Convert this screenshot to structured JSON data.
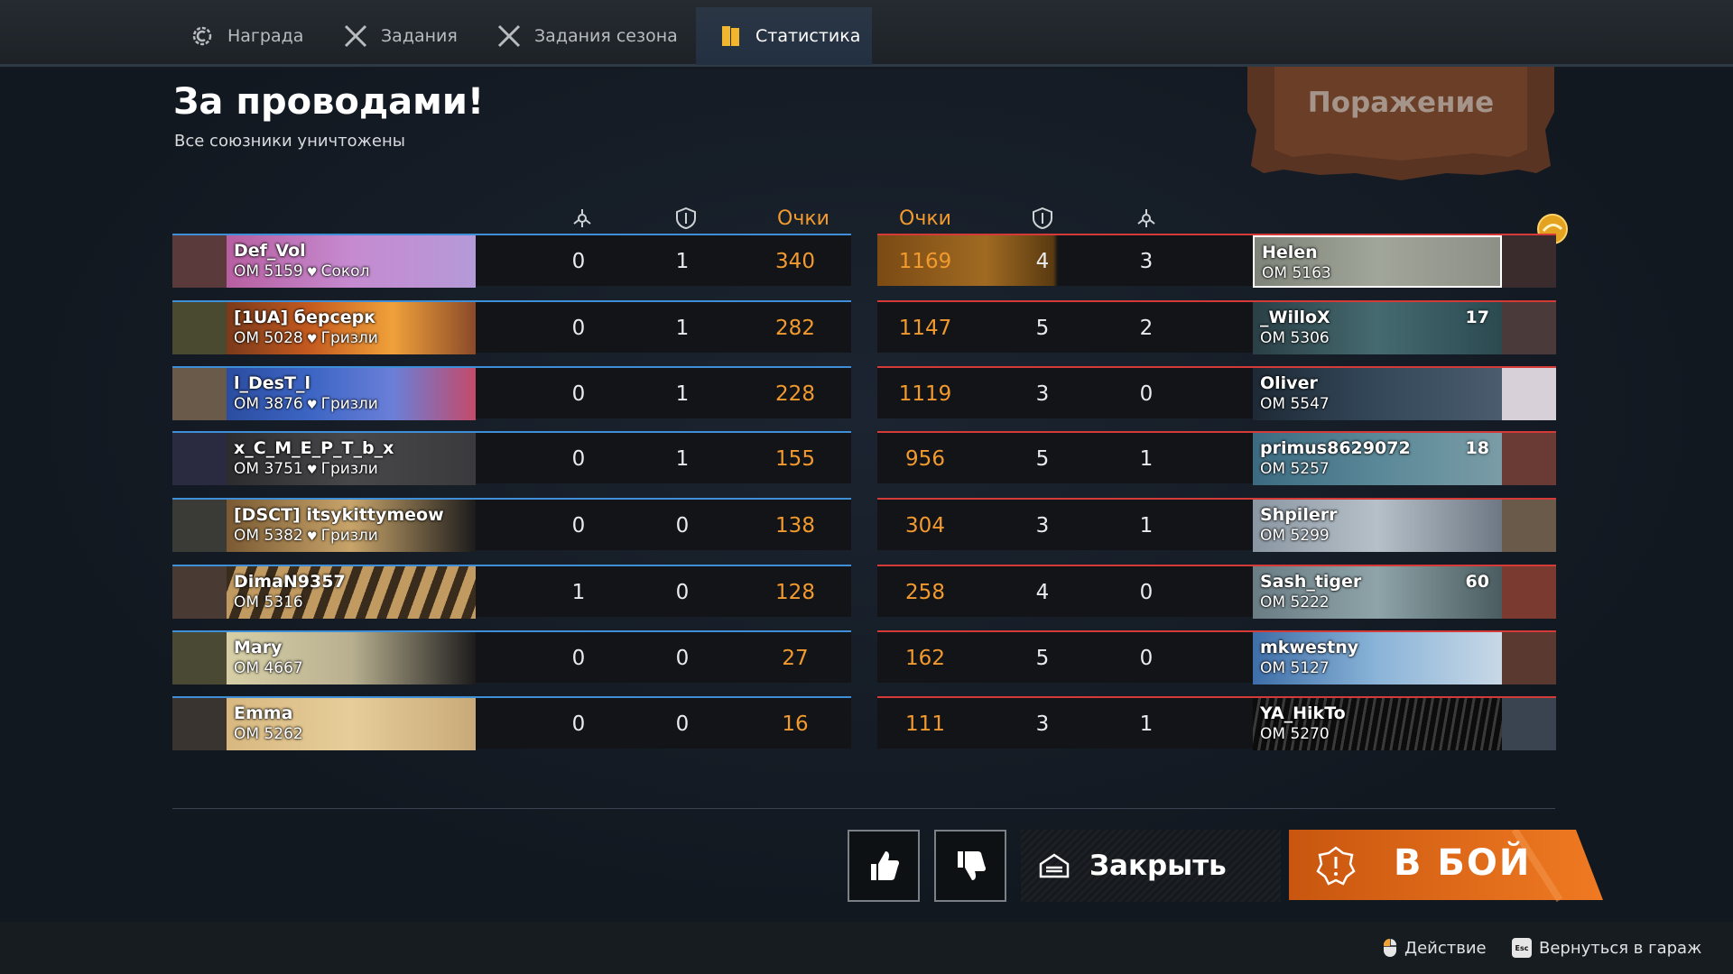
{
  "tabs": [
    {
      "label": "Награда",
      "icon": "reward-gear-icon",
      "active": false
    },
    {
      "label": "Задания",
      "icon": "crossed-swords-icon",
      "active": false
    },
    {
      "label": "Задания сезона",
      "icon": "crossed-swords-icon",
      "active": false
    },
    {
      "label": "Статистика",
      "icon": "stats-book-icon",
      "active": true
    }
  ],
  "header": {
    "title": "За проводами!",
    "subtitle": "Все союзники уничтожены",
    "result": "Поражение"
  },
  "columns": {
    "left": {
      "kills_icon": "kills-icon",
      "assists_icon": "shield-icon",
      "score": "Очки"
    },
    "right": {
      "score": "Очки",
      "assists_icon": "shield-icon",
      "kills_icon": "kills-icon"
    }
  },
  "allies": [
    {
      "name": "Def_Vol",
      "om": "ОМ 5159",
      "clan": "Сокол",
      "kills": "0",
      "assists": "1",
      "score": "340"
    },
    {
      "name": "[1UA] берсерк",
      "om": "ОМ 5028",
      "clan": "Гризли",
      "kills": "0",
      "assists": "1",
      "score": "282"
    },
    {
      "name": "l_DesT_l",
      "om": "ОМ 3876",
      "clan": "Гризли",
      "kills": "0",
      "assists": "1",
      "score": "228"
    },
    {
      "name": "x_C_M_E_P_T_b_x",
      "om": "ОМ 3751",
      "clan": "Гризли",
      "kills": "0",
      "assists": "1",
      "score": "155"
    },
    {
      "name": "[DSCT] itsykittymeow",
      "om": "ОМ 5382",
      "clan": "Гризли",
      "kills": "0",
      "assists": "0",
      "score": "138"
    },
    {
      "name": "DimaN9357",
      "om": "ОМ 5316",
      "clan": "",
      "kills": "1",
      "assists": "0",
      "score": "128"
    },
    {
      "name": "Mary",
      "om": "ОМ 4667",
      "clan": "",
      "kills": "0",
      "assists": "0",
      "score": "27"
    },
    {
      "name": "Emma",
      "om": "ОМ 5262",
      "clan": "",
      "kills": "0",
      "assists": "0",
      "score": "16"
    }
  ],
  "enemies": [
    {
      "name": "Helen",
      "om": "ОМ 5163",
      "level": "",
      "score": "1169",
      "assists": "4",
      "kills": "3"
    },
    {
      "name": "_WilloX",
      "om": "ОМ 5306",
      "level": "17",
      "score": "1147",
      "assists": "5",
      "kills": "2"
    },
    {
      "name": "Oliver",
      "om": "ОМ 5547",
      "level": "",
      "score": "1119",
      "assists": "3",
      "kills": "0"
    },
    {
      "name": "primus8629072",
      "om": "ОМ 5257",
      "level": "18",
      "score": "956",
      "assists": "5",
      "kills": "1"
    },
    {
      "name": "Shpilerr",
      "om": "ОМ 5299",
      "level": "",
      "score": "304",
      "assists": "3",
      "kills": "1"
    },
    {
      "name": "Sash_tiger",
      "om": "ОМ 5222",
      "level": "60",
      "score": "258",
      "assists": "4",
      "kills": "0"
    },
    {
      "name": "mkwestny",
      "om": "ОМ 5127",
      "level": "",
      "score": "162",
      "assists": "5",
      "kills": "0"
    },
    {
      "name": "YA_HikTo",
      "om": "ОМ 5270",
      "level": "",
      "score": "111",
      "assists": "3",
      "kills": "1"
    }
  ],
  "buttons": {
    "like_icon": "thumbs-up-icon",
    "dislike_icon": "thumbs-down-icon",
    "close_label": "Закрыть",
    "fight_label": "В БОЙ"
  },
  "footer": {
    "action_label": "Действие",
    "action_key": "mouse-icon",
    "back_label": "Вернуться в гараж",
    "back_key": "Esc"
  },
  "colors": {
    "score_orange": "#f29a2e",
    "ally_blue": "#3e8ed8",
    "enemy_red": "#d33a38",
    "fight_orange": "#e06a17"
  }
}
